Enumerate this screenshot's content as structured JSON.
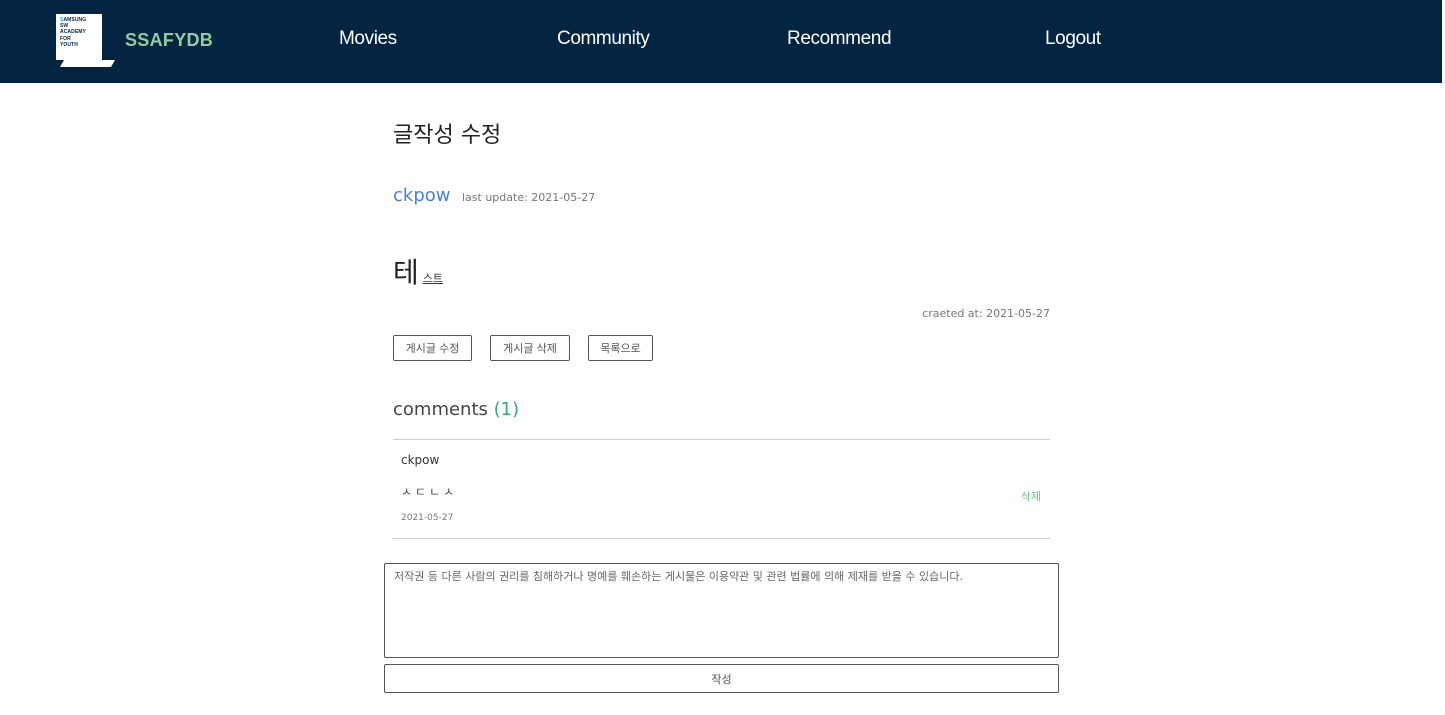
{
  "navbar": {
    "logo_lines": [
      "SAMSUNG",
      "SW",
      "ACADEMY",
      "FOR",
      "YOUTH"
    ],
    "brand": "SSAFYDB",
    "links": [
      "Movies",
      "Community",
      "Recommend",
      "Logout"
    ]
  },
  "post": {
    "page_title": "글작성 수정",
    "author": "ckpow",
    "last_update": "last update: 2021-05-27",
    "title_main": "테",
    "title_small": "스트",
    "created_at": "craeted at: 2021-05-27",
    "buttons": [
      "게시글 수정",
      "게시글 삭제",
      "목록으로"
    ]
  },
  "comments": {
    "label": "comments",
    "count": "(1)",
    "items": [
      {
        "author": "ckpow",
        "body": "ㅅㄷㄴㅅ",
        "date": "2021-05-27",
        "delete_label": "삭제"
      }
    ]
  },
  "comment_form": {
    "placeholder": "저작권 등 다른 사람의 권리를 침해하거나 명예를 훼손하는 게시물은 이용약관 및 관련 법률에 의해 제재를 받을 수 있습니다.",
    "submit_label": "작성"
  },
  "colors": {
    "navbar_bg": "#032541",
    "brand": "#90cea1",
    "author_link": "#4a7fd8",
    "accent_green": "#3aa776"
  }
}
